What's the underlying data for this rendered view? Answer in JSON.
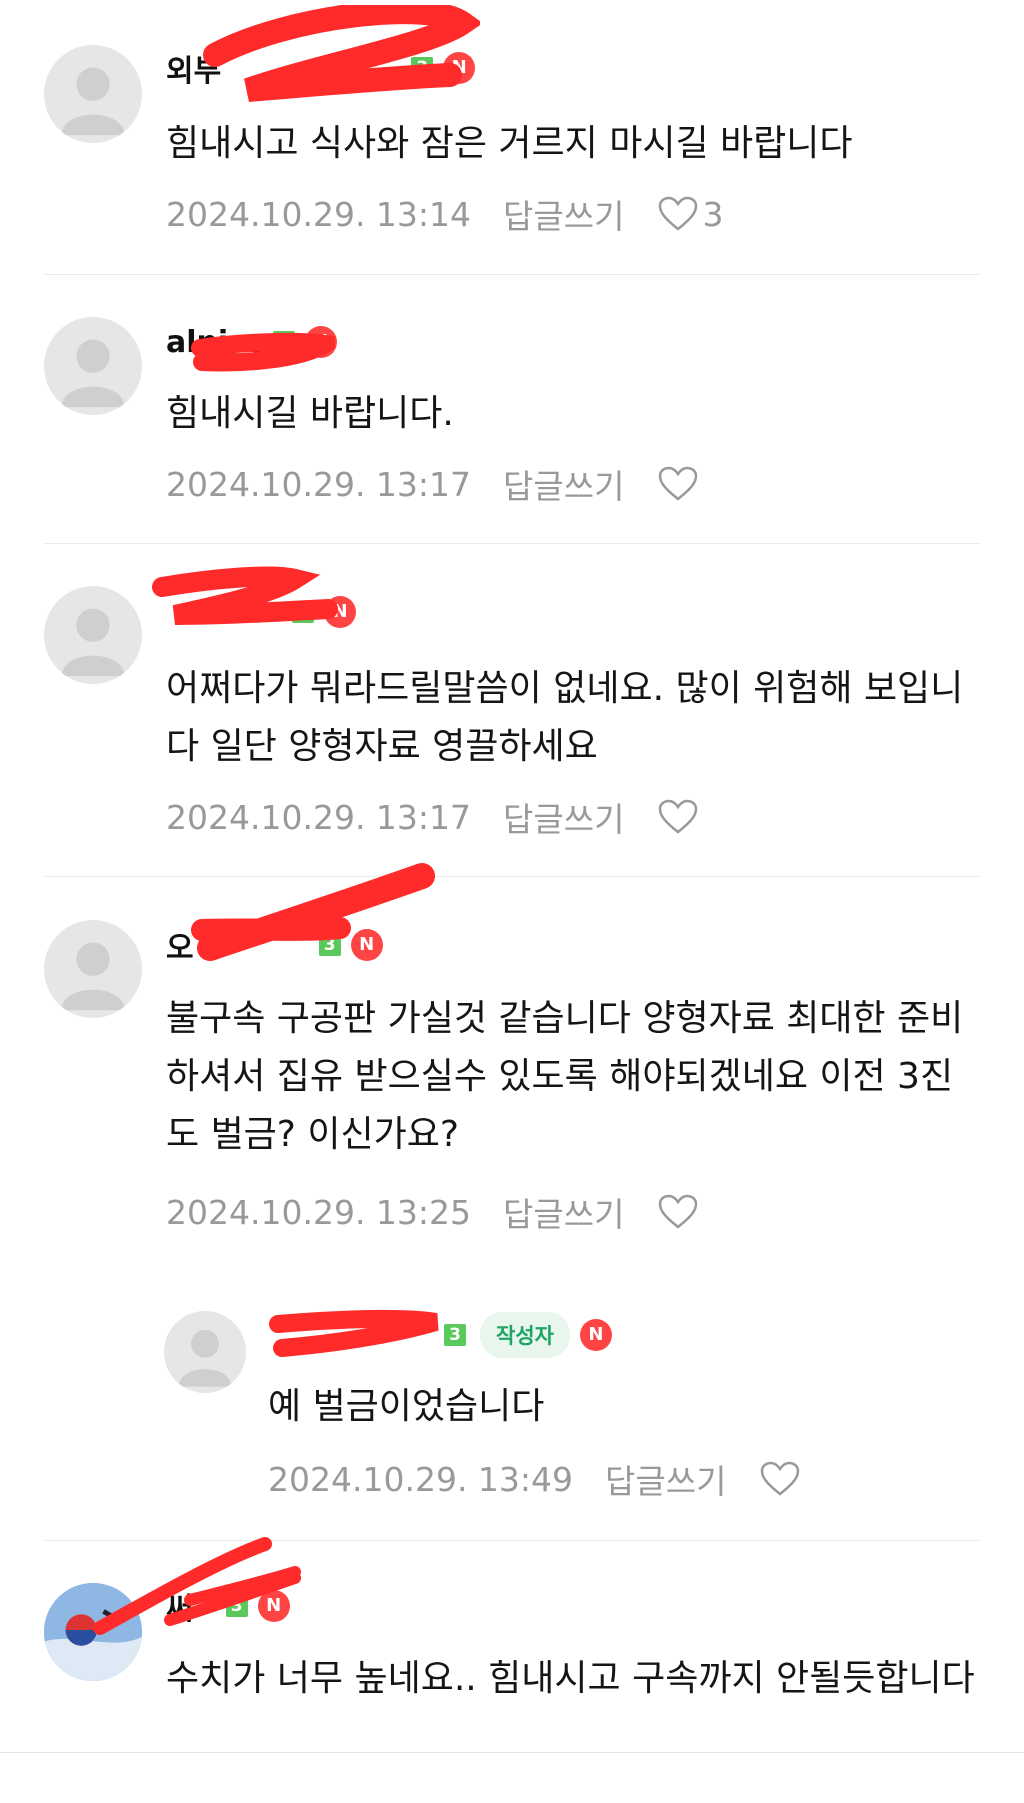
{
  "colors": {
    "level_badge": "#5ac85a",
    "new_badge": "#ff4444",
    "author_badge_bg": "#e8f6ee",
    "author_badge_text": "#1fa464",
    "meta_text": "#999999",
    "redaction": "#ff2a2a"
  },
  "badges": {
    "new": "N",
    "author": "작성자"
  },
  "comments": [
    {
      "nick": "외부",
      "level": "3",
      "text": "힘내시고 식사와 잠은 거르지 마시길 바랍니다",
      "date": "2024.10.29. 13:14",
      "reply_label": "답글쓰기",
      "likes": "3"
    },
    {
      "nick": "alnico",
      "level": "3",
      "text": "힘내시길 바랍니다.",
      "date": "2024.10.29. 13:17",
      "reply_label": "답글쓰기",
      "likes": ""
    },
    {
      "nick": "",
      "level": "3",
      "text": "어쩌다가 뭐라드릴말씀이 없네요. 많이 위험해 보입니다 일단 양형자료 영끌하세요",
      "date": "2024.10.29. 13:17",
      "reply_label": "답글쓰기",
      "likes": ""
    },
    {
      "nick": "오",
      "level": "3",
      "text": "불구속 구공판 가실것 같습니다 양형자료 최대한 준비하셔서 집유 받으실수 있도록 해야되겠네요 이전 3진도 벌금? 이신가요?",
      "date": "2024.10.29. 13:25",
      "reply_label": "답글쓰기",
      "likes": ""
    },
    {
      "nick": "",
      "level": "3",
      "text": "예 벌금이었습니다",
      "date": "2024.10.29. 13:49",
      "reply_label": "답글쓰기",
      "likes": ""
    },
    {
      "nick": "써",
      "level": "3",
      "text": "수치가 너무 높네요.. 힘내시고 구속까지 안될듯합니다",
      "date": "",
      "reply_label": "",
      "likes": ""
    }
  ]
}
